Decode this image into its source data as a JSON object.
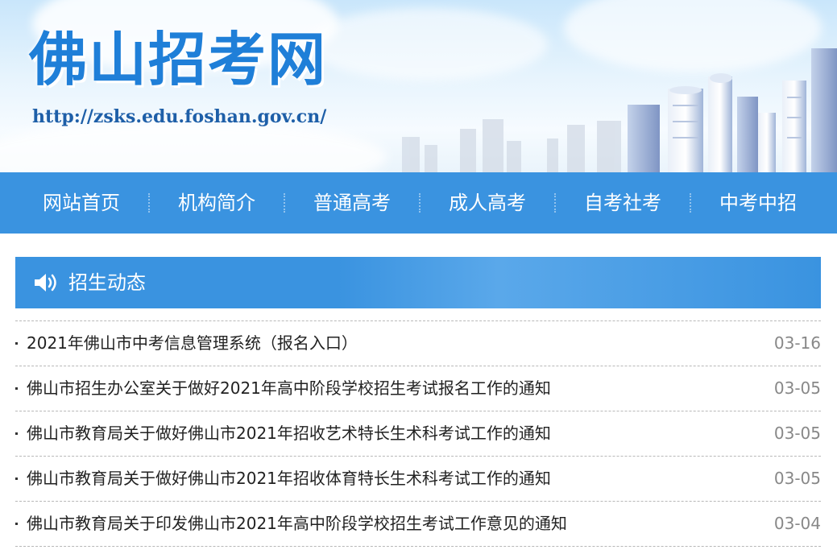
{
  "banner": {
    "site_name": "佛山招考网",
    "url": "http://zsks.edu.foshan.gov.cn/"
  },
  "nav": {
    "items": [
      "网站首页",
      "机构简介",
      "普通高考",
      "成人高考",
      "自考社考",
      "中考中招"
    ]
  },
  "section": {
    "title": "招生动态",
    "icon": "speaker-icon"
  },
  "news": [
    {
      "title": "2021年佛山市中考信息管理系统（报名入口）",
      "date": "03-16"
    },
    {
      "title": "佛山市招生办公室关于做好2021年高中阶段学校招生考试报名工作的通知",
      "date": "03-05"
    },
    {
      "title": "佛山市教育局关于做好佛山市2021年招收艺术特长生术科考试工作的通知",
      "date": "03-05"
    },
    {
      "title": "佛山市教育局关于做好佛山市2021年招收体育特长生术科考试工作的通知",
      "date": "03-05"
    },
    {
      "title": "佛山市教育局关于印发佛山市2021年高中阶段学校招生考试工作意见的通知",
      "date": "03-04"
    }
  ],
  "colors": {
    "nav_bg": "#3a93e0",
    "logo": "#1f7fd8",
    "date": "#888888"
  }
}
